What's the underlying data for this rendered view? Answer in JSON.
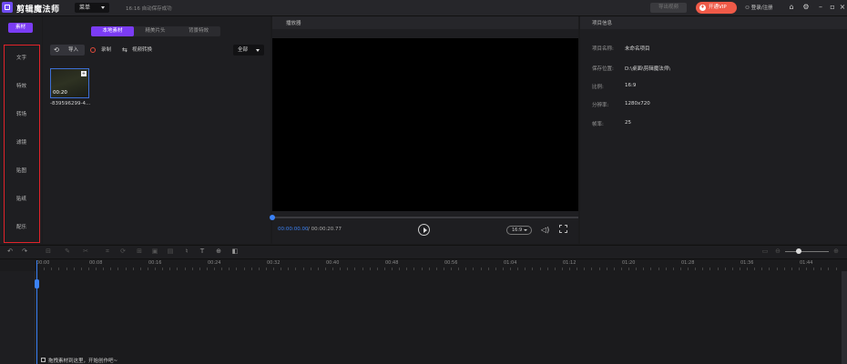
{
  "titlebar": {
    "app_name": "剪辑魔法师",
    "menu_label": "菜单",
    "save_status": "16:16 自动保存成功",
    "export_label": "导出视频",
    "vip_label": "开通VIP",
    "login_label": "登录/注册",
    "icons": [
      "home-icon",
      "settings-icon",
      "minimize-icon",
      "maximize-icon",
      "close-icon"
    ]
  },
  "categories": {
    "top_label": "素材",
    "items": [
      "文字",
      "特效",
      "转场",
      "滤镜",
      "贴图",
      "贴纸",
      "配乐"
    ]
  },
  "media": {
    "tabs": [
      "本地素材",
      "精美片头",
      "背景特效"
    ],
    "active_tab": 0,
    "import_label": "导入",
    "record_label": "录制",
    "convert_label": "视频转换",
    "filter_value": "全部",
    "clip": {
      "duration": "00:20",
      "name": "-839596299-4..."
    }
  },
  "player": {
    "title": "播放器",
    "current_time": "00:00:00.00",
    "total_time": "/ 00:00:20.77",
    "ratio": "16:9"
  },
  "project_info": {
    "title": "项目信息",
    "rows": [
      {
        "label": "项目名称:",
        "value": "未命名项目"
      },
      {
        "label": "保存位置:",
        "value": "D:\\桌面\\剪辑魔法师\\"
      },
      {
        "label": "比例:",
        "value": "16:9"
      },
      {
        "label": "分辨率:",
        "value": "1280x720"
      },
      {
        "label": "帧率:",
        "value": "25"
      }
    ]
  },
  "timeline": {
    "ticks": [
      "00:00",
      "00:08",
      "00:16",
      "00:24",
      "00:32",
      "00:40",
      "00:48",
      "00:56",
      "01:04",
      "01:12",
      "01:20",
      "01:28",
      "01:36",
      "01:44"
    ],
    "drop_hint": "拖拽素材到这里，开始创作吧~"
  },
  "colors": {
    "accent": "#7b3cf5",
    "vip": "#ef5a48",
    "playhead": "#3b82f6",
    "highlight_border": "#e0232a"
  }
}
